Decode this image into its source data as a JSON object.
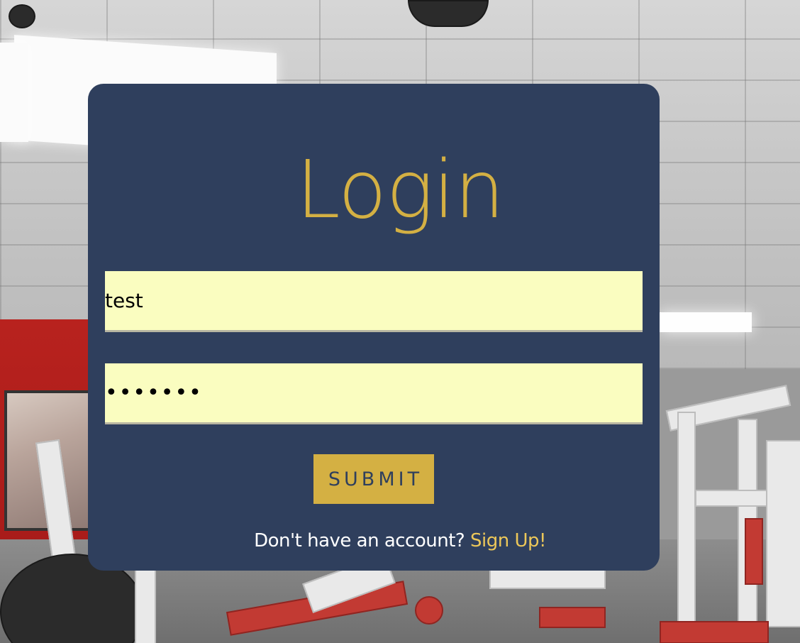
{
  "login": {
    "title": "Login",
    "username_value": "test",
    "password_value": "•••••••",
    "submit_label": "SUBMIT",
    "signup_prompt": "Don't have an account?",
    "signup_link": "Sign Up!"
  },
  "colors": {
    "card_background": "#2f3f5d",
    "accent_gold": "#d4b043",
    "input_background": "#fafdc0",
    "link_gold": "#ecc759"
  }
}
